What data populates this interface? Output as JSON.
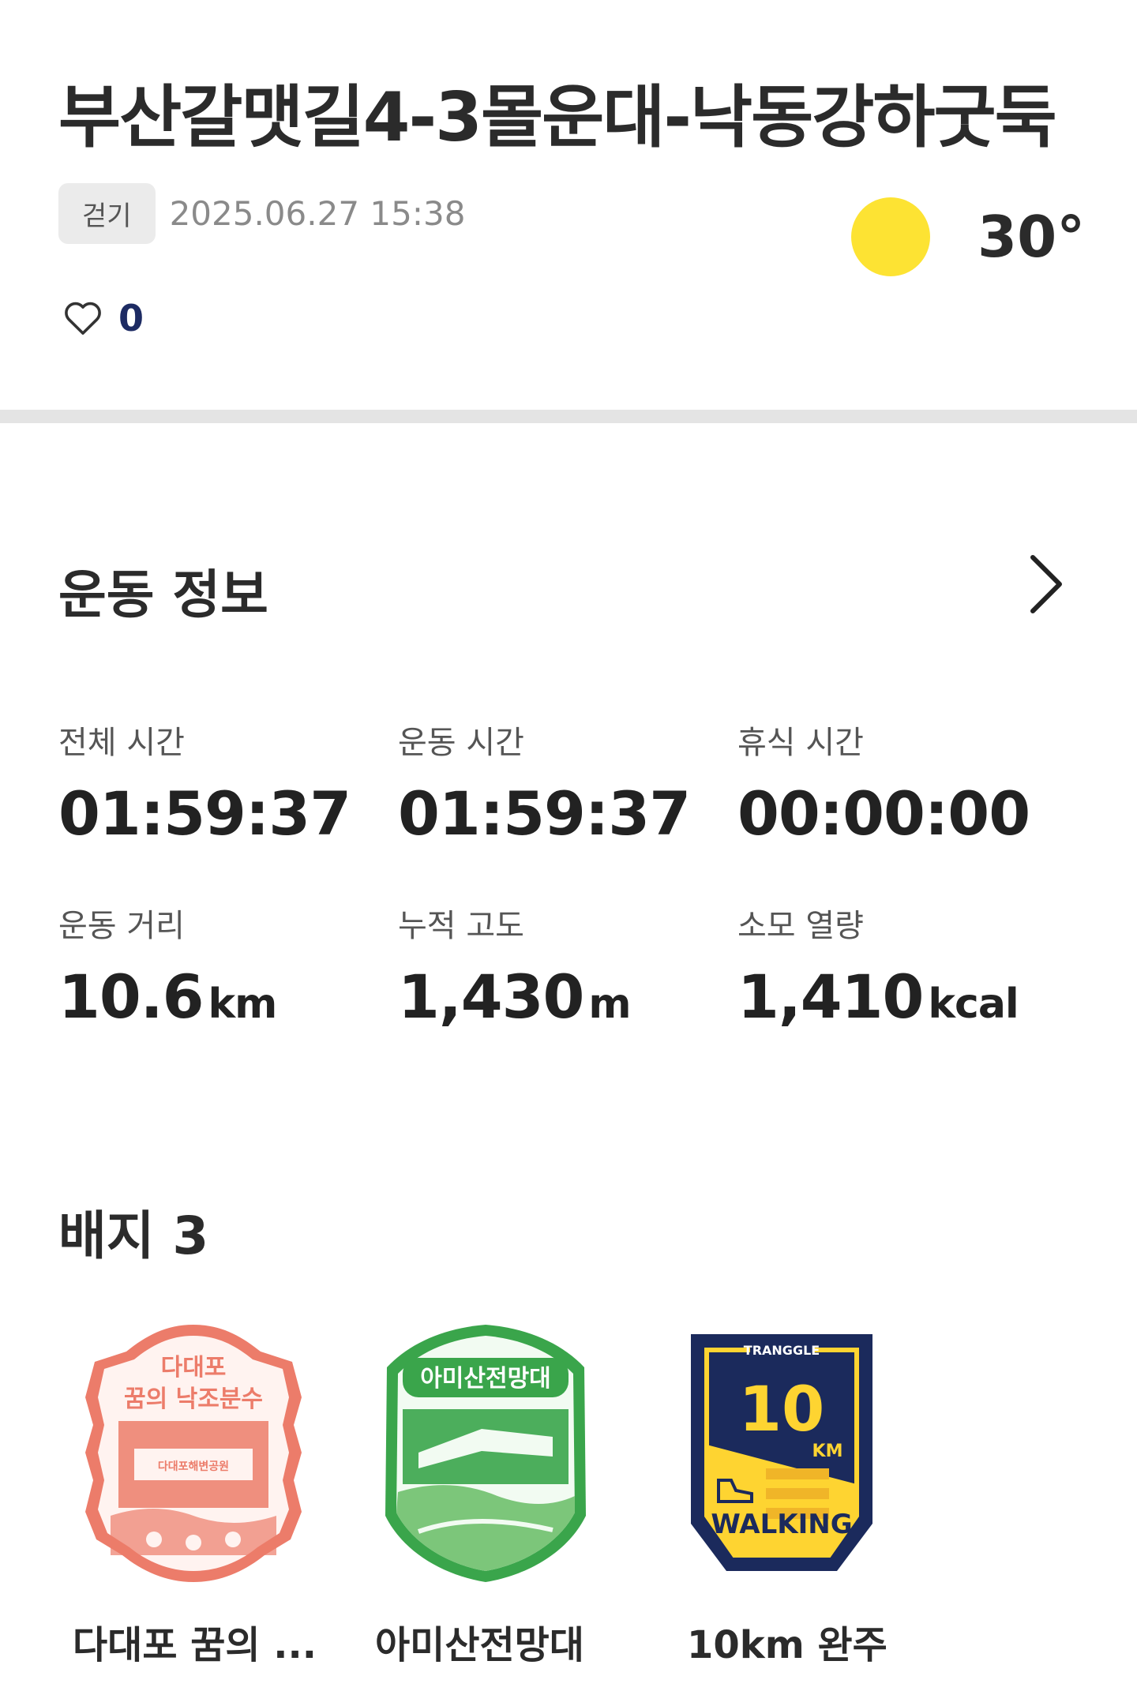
{
  "header": {
    "title": "부산갈맷길4-3몰운대-낙동강하굿둑",
    "activity_tag": "걷기",
    "datetime": "2025.06.27 15:38",
    "weather_icon": "sun-icon",
    "temperature": "30°",
    "likes": "0"
  },
  "exercise": {
    "title": "운동 정보",
    "stats": [
      {
        "label": "전체 시간",
        "value": "01:59:37",
        "unit": ""
      },
      {
        "label": "운동 시간",
        "value": "01:59:37",
        "unit": ""
      },
      {
        "label": "휴식 시간",
        "value": "00:00:00",
        "unit": ""
      },
      {
        "label": "운동 거리",
        "value": "10.6",
        "unit": "km"
      },
      {
        "label": "누적 고도",
        "value": "1,430",
        "unit": "m"
      },
      {
        "label": "소모 열량",
        "value": "1,410",
        "unit": "kcal"
      }
    ]
  },
  "badges": {
    "title": "배지 3",
    "items": [
      {
        "name": "다대포 꿈의 ...",
        "stamp_line1": "다대포",
        "stamp_line2": "꿈의 낙조분수",
        "stamp_line3": "다대포해변공원",
        "color": "#ec7c6a"
      },
      {
        "name": "아미산전망대",
        "stamp_line1": "아미산전망대",
        "color": "#3aa54b"
      },
      {
        "name": "10km 완주",
        "brand": "TRANGGLE",
        "number": "10",
        "unit": "KM",
        "kind": "WALKING",
        "color": "#1b2a5c",
        "accent": "#fed431"
      }
    ]
  }
}
